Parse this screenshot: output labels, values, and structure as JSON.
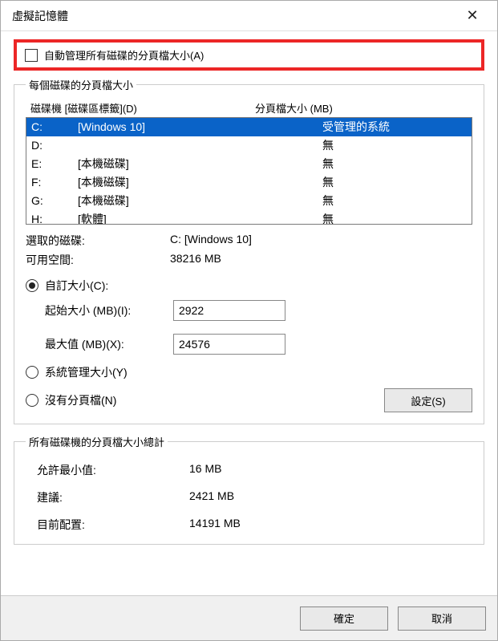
{
  "window": {
    "title": "虛擬記憶體"
  },
  "auto_manage": {
    "label": "自動管理所有磁碟的分頁檔大小(A)",
    "checked": false
  },
  "per_drive": {
    "legend": "每個磁碟的分頁檔大小",
    "headers": {
      "drive": "磁碟機 [磁碟區標籤](D)",
      "size": "分頁檔大小 (MB)"
    },
    "drives": [
      {
        "letter": "C:",
        "label": "[Windows 10]",
        "size": "受管理的系統",
        "selected": true
      },
      {
        "letter": "D:",
        "label": "",
        "size": "無"
      },
      {
        "letter": "E:",
        "label": "[本機磁碟]",
        "size": "無"
      },
      {
        "letter": "F:",
        "label": "[本機磁碟]",
        "size": "無"
      },
      {
        "letter": "G:",
        "label": "[本機磁碟]",
        "size": "無"
      },
      {
        "letter": "H:",
        "label": "[軟體]",
        "size": "無"
      }
    ],
    "selected_drive_label": "選取的磁碟:",
    "selected_drive_value": "C:  [Windows 10]",
    "free_space_label": "可用空間:",
    "free_space_value": "38216 MB",
    "custom_size_label": "自訂大小(C):",
    "initial_label": "起始大小 (MB)(I):",
    "initial_value": "2922",
    "max_label": "最大值 (MB)(X):",
    "max_value": "24576",
    "system_managed_label": "系統管理大小(Y)",
    "no_paging_label": "沒有分頁檔(N)",
    "set_button": "設定(S)",
    "size_mode": "custom"
  },
  "totals": {
    "legend": "所有磁碟機的分頁檔大小總計",
    "min_label": "允許最小值:",
    "min_value": "16 MB",
    "rec_label": "建議:",
    "rec_value": "2421 MB",
    "cur_label": "目前配置:",
    "cur_value": "14191 MB"
  },
  "footer": {
    "ok": "確定",
    "cancel": "取消"
  }
}
